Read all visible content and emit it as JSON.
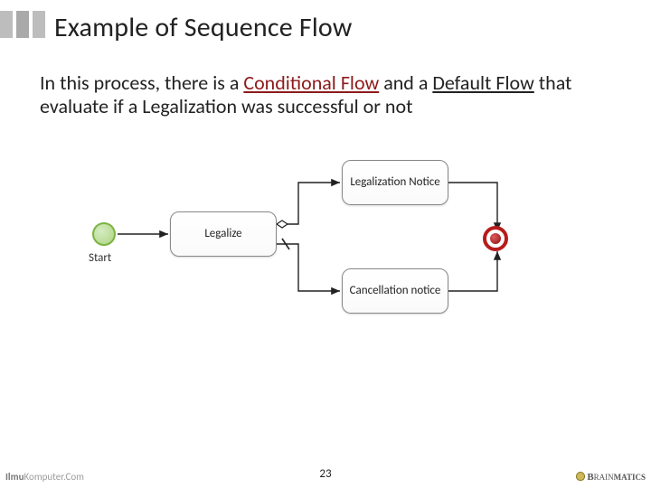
{
  "header": {
    "title": "Example of Sequence Flow"
  },
  "body": {
    "desc_pre": "In this process, there is a ",
    "cond": "Conditional Flow",
    "desc_mid": " and a ",
    "deft": "Default Flow",
    "desc_post": " that evaluate if a Legalization was successful or not"
  },
  "diagram": {
    "start_label": "Start",
    "tasks": {
      "legalize": "Legalize",
      "notice": "Legalization Notice",
      "cancel": "Cancellation notice"
    }
  },
  "footer": {
    "page": "23"
  },
  "brand": {
    "left_a": "Ilmu",
    "left_b": "Komputer",
    "left_c": ".Com",
    "right_a": "B",
    "right_b": "RAIN",
    "right_c": "MATICS"
  }
}
